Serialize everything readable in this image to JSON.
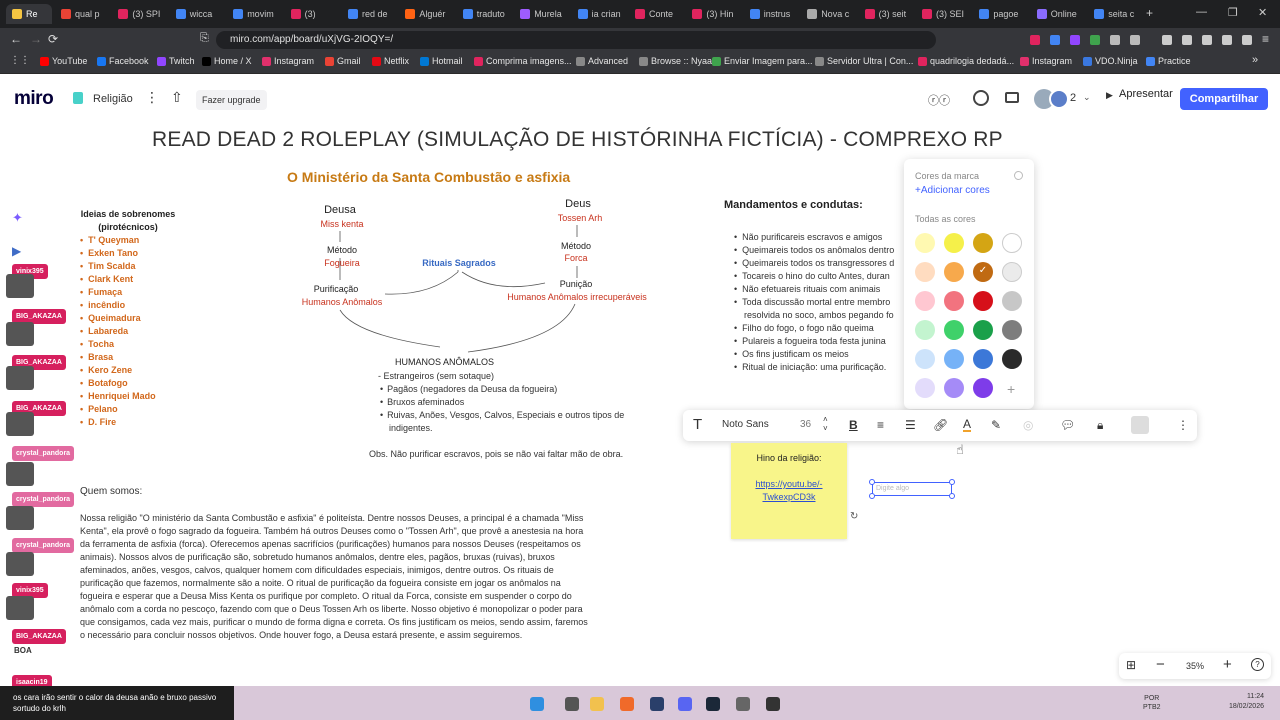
{
  "browser": {
    "tabs": [
      {
        "label": "Re",
        "color": "#f5c542"
      },
      {
        "label": "qual p",
        "color": "#ea4335"
      },
      {
        "label": "(3) SPI",
        "color": "#e0245e"
      },
      {
        "label": "wicca",
        "color": "#4285f4"
      },
      {
        "label": "movim",
        "color": "#4285f4"
      },
      {
        "label": "(3)",
        "color": "#e0245e"
      },
      {
        "label": "red de",
        "color": "#4285f4"
      },
      {
        "label": "Alguér",
        "color": "#ff6314"
      },
      {
        "label": "traduto",
        "color": "#4285f4"
      },
      {
        "label": "Murela",
        "color": "#9e5cff"
      },
      {
        "label": "ia crian",
        "color": "#4285f4"
      },
      {
        "label": "Conte",
        "color": "#e0245e"
      },
      {
        "label": "(3) Hin",
        "color": "#e0245e"
      },
      {
        "label": "instrus",
        "color": "#4285f4"
      },
      {
        "label": "Nova c",
        "color": "#aaaaaa"
      },
      {
        "label": "(3) seit",
        "color": "#e0245e"
      },
      {
        "label": "(3) SEI",
        "color": "#e0245e"
      },
      {
        "label": "pagoe",
        "color": "#4285f4"
      },
      {
        "label": "Online",
        "color": "#8a6cff"
      },
      {
        "label": "seita c",
        "color": "#4285f4"
      }
    ],
    "new_tab": "+",
    "url": "miro.com/app/board/uXjVG-2IOQY=/",
    "bookmarks": [
      {
        "label": "YouTube",
        "color": "#ff0000"
      },
      {
        "label": "Facebook",
        "color": "#1877f2"
      },
      {
        "label": "Twitch",
        "color": "#9146ff"
      },
      {
        "label": "Home / X",
        "color": "#000000"
      },
      {
        "label": "Instagram",
        "color": "#e1306c"
      },
      {
        "label": "Gmail",
        "color": "#ea4335"
      },
      {
        "label": "Netflix",
        "color": "#e50914"
      },
      {
        "label": "Hotmail",
        "color": "#0078d4"
      },
      {
        "label": "Comprima imagens...",
        "color": "#e0245e"
      },
      {
        "label": "Advanced",
        "color": "#888888"
      },
      {
        "label": "Browse :: Nyaa",
        "color": "#888888"
      },
      {
        "label": "Enviar Imagem para...",
        "color": "#3fa34d"
      },
      {
        "label": "Servidor Ultra | Con...",
        "color": "#888888"
      },
      {
        "label": "quadrilogia dedadá...",
        "color": "#e0245e"
      },
      {
        "label": "Instagram",
        "color": "#e1306c"
      },
      {
        "label": "VDO.Ninja",
        "color": "#3a78e0"
      },
      {
        "label": "Practice",
        "color": "#4285f4"
      }
    ]
  },
  "miro": {
    "logo": "miro",
    "board_name": "Religião",
    "upgrade": "Fazer upgrade",
    "collaborators": "2",
    "present": "Apresentar",
    "share": "Compartilhar",
    "accent": "#4262ff"
  },
  "board": {
    "title": "READ DEAD 2 ROLEPLAY (SIMULAÇÃO DE HISTÓRINHA FICTÍCIA) - COMPREXO RP",
    "ministry": "O Ministério da Santa Combustão e asfixia",
    "surnames_title": "Ideias de sobrenomes (pirotécnicos)",
    "surnames": [
      "T' Queyman",
      "Exken Tano",
      "Tim Scalda",
      "Clark Kent",
      "Fumaça",
      "incêndio",
      "Queimadura",
      "Labareda",
      "Tocha",
      "Brasa",
      "Kero Zene",
      "Botafogo",
      "Henriquei Mado",
      "Pelano",
      "D. Fire"
    ],
    "deusa": {
      "title": "Deusa",
      "name": "Miss kenta",
      "metodo": "Método",
      "metodo_val": "Fogueira",
      "purificacao": "Purificação",
      "purificacao_val": "Humanos Anômalos"
    },
    "deus": {
      "title": "Deus",
      "name": "Tossen Arh",
      "metodo": "Método",
      "metodo_val": "Forca",
      "punicao": "Punição",
      "punicao_val": "Humanos Anômalos irrecuperáveis"
    },
    "rituais": "Rituais Sagrados",
    "humanos_title": "HUMANOS ANÔMALOS",
    "humanos": [
      {
        "text": "- Estrangeiros (sem sotaque)",
        "sub": false
      },
      {
        "text": "Pagãos (negadores da Deusa da fogueira)",
        "sub": true
      },
      {
        "text": "Bruxos afeminados",
        "sub": true
      },
      {
        "text": "Ruivas, Anões, Vesgos, Calvos, Especiais e outros tipos de indigentes.",
        "sub": true
      }
    ],
    "obs": "Obs. Não purificar escravos, pois se não vai faltar mão de obra.",
    "mandamentos_title": "Mandamentos e condutas:",
    "mandamentos": [
      {
        "text": "Não purificareis escravos e amigos",
        "cont": false
      },
      {
        "text": "Queimareis todos os anômalos dentro",
        "cont": false
      },
      {
        "text": "Queimareis todos os transgressores d",
        "cont": false
      },
      {
        "text": "Tocareis o hino do culto Antes, duran",
        "cont": false
      },
      {
        "text": "Não efetuareis rituais com animais",
        "cont": false
      },
      {
        "text": "Toda discussão mortal entre membro",
        "cont": false
      },
      {
        "text": "resolvida no soco, ambos pegando fo",
        "cont": true
      },
      {
        "text": "Filho do fogo, o fogo não queima",
        "cont": false
      },
      {
        "text": "Pulareis a fogueira toda festa junina",
        "cont": false
      },
      {
        "text": "Os fins justificam os meios",
        "cont": false
      },
      {
        "text": "Ritual de iniciação: uma purificação.",
        "cont": false
      }
    ],
    "quem_somos": "Quem somos:",
    "about": "Nossa religião \"O ministério da Santa Combustão e asfixia\" é politeísta. Dentre nossos Deuses, a principal é a chamada \"Miss Kenta\", ela provê o fogo sagrado da fogueira. Também há outros Deuses como o \"Tossen Arh\", que provê a anestesia na hora da ferramenta de asfixia (forca). Oferecemos apenas sacrifícios (purificações) humanos para nossos Deuses (respeitamos os animais). Nossos alvos de purificação são, sobretudo humanos anômalos, dentre eles, pagãos, bruxas (ruivas), bruxos afeminados, anões, vesgos, calvos, qualquer homem com dificuldades especiais, inimigos, dentre outros. Os rituais de purificação que fazemos, normalmente são a noite. O ritual de purificação da fogueira consiste em jogar os anômalos na fogueira e esperar que a Deusa Miss Kenta os purifique por completo. O ritual da Forca, consiste em suspender o corpo do anômalo com a corda no pescoço, fazendo com que o Deus Tossen Arh os liberte. Nosso objetivo é monopolizar o poder para que consigamos, cada vez mais, purificar o mundo de forma digna e correta. Os fins justificam os meios, sendo assim, faremos o necessário para concluir nossos objetivos. Onde houver fogo, a Deusa estará presente, e assim seguiremos.",
    "sticky_title": "Hino da religião:",
    "sticky_link": "https://youtu.be/-TwkexpCD3k",
    "textbox_placeholder": "Digite algo"
  },
  "picker": {
    "brand_label": "Cores da marca",
    "add_label": "+Adicionar cores",
    "all_label": "Todas as cores",
    "colors": [
      [
        "#fff9b1",
        "#f5f04a",
        "#d4a514",
        "#ffffff"
      ],
      [
        "#ffdcc0",
        "#f7a94c",
        "#c06a12",
        "#ebebeb"
      ],
      [
        "#ffc7d1",
        "#f2737f",
        "#d6101a",
        "#c7c7c7"
      ],
      [
        "#c3f4cf",
        "#3fd16a",
        "#1aa04a",
        "#7d7d7d"
      ],
      [
        "#cde3fb",
        "#76b2f7",
        "#3c78d8",
        "#2a2a2a"
      ],
      [
        "#e3dcfb",
        "#a58bf7",
        "#7e3ce9",
        null
      ]
    ],
    "selected": "#c06a12"
  },
  "text_toolbar": {
    "font": "Noto Sans",
    "size": "36"
  },
  "cursors": [
    {
      "label": "vinix395",
      "color": "#d6205e"
    },
    {
      "label": "BIG_AKAZAA",
      "color": "#d6205e"
    },
    {
      "label": "BIG_AKAZAA",
      "color": "#d6205e"
    },
    {
      "label": "BIG_AKAZAA",
      "color": "#d6205e"
    },
    {
      "label": "crystal_pandora",
      "color": "#e26aa0"
    },
    {
      "label": "crystal_pandora",
      "color": "#e26aa0"
    },
    {
      "label": "crystal_pandora",
      "color": "#e26aa0"
    },
    {
      "label": "vinix395",
      "color": "#d6205e"
    },
    {
      "label": "BIG_AKAZAA",
      "color": "#d6205e"
    },
    {
      "label": "isaacin19",
      "color": "#d6205e"
    }
  ],
  "boa": "BOA",
  "zoom": {
    "value": "35%",
    "minus": "−",
    "plus": "+"
  },
  "chat": "os cara irão sentir o calor da deusa anão e bruxo passivo sortudo do krlh",
  "system": {
    "lang_top": "POR",
    "lang_bottom": "PTB2",
    "time": "11:24",
    "date": "18/02/2026"
  }
}
